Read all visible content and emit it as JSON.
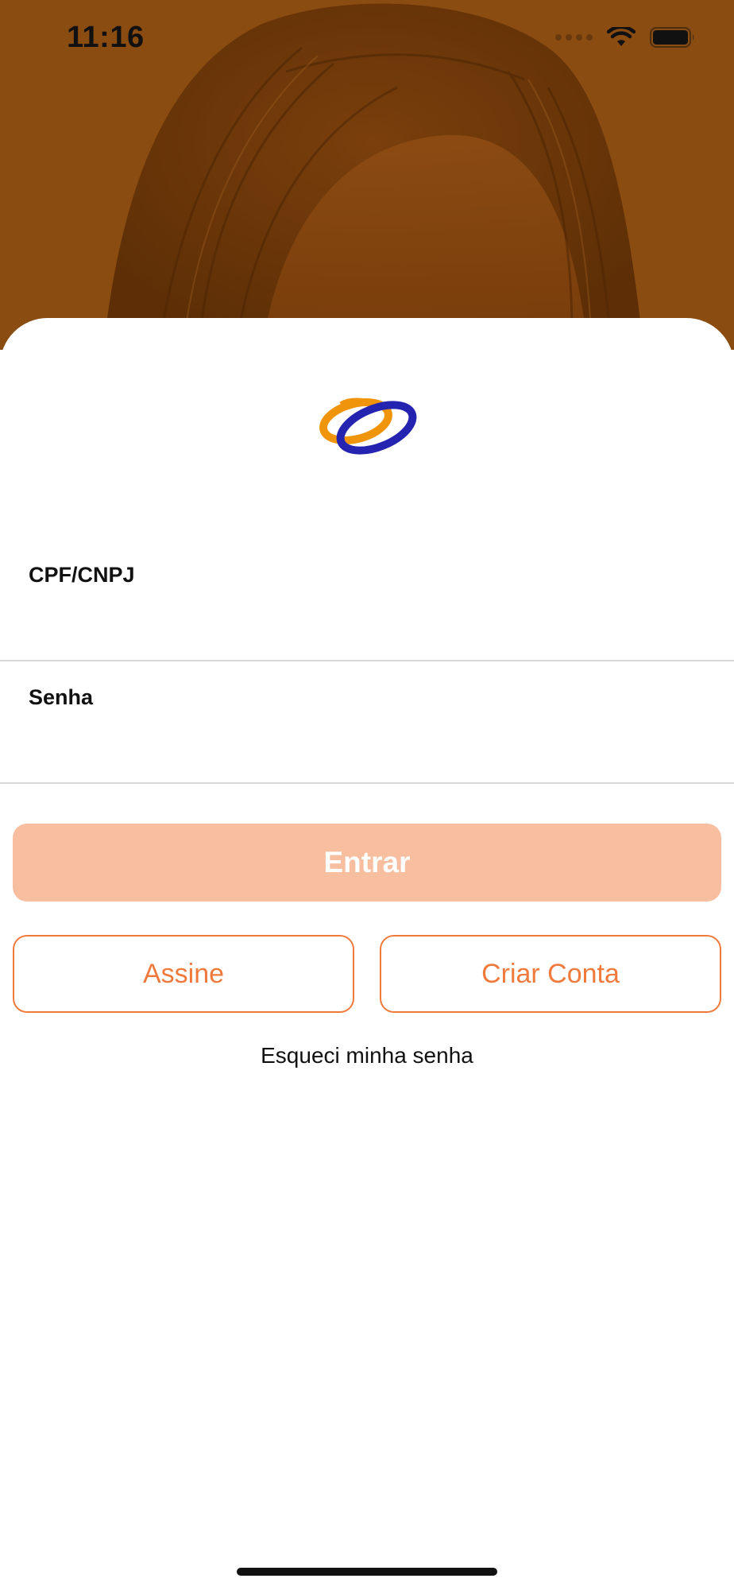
{
  "status_bar": {
    "time": "11:16",
    "icons": [
      "cellular-signal-icon",
      "wifi-icon",
      "battery-icon"
    ]
  },
  "hero": {
    "image": "woman-portrait-photo",
    "tint_color": "#8a4a10"
  },
  "logo": {
    "icon": "rings-logo",
    "colors": {
      "orange": "#f0940c",
      "blue": "#2424b0"
    }
  },
  "form": {
    "cpf_label": "CPF/CNPJ",
    "cpf_value": "",
    "senha_label": "Senha",
    "senha_value": ""
  },
  "buttons": {
    "entrar": "Entrar",
    "assine": "Assine",
    "criar_conta": "Criar Conta"
  },
  "links": {
    "forgot_password": "Esqueci minha senha"
  },
  "colors": {
    "accent": "#f07a3c",
    "primary_disabled": "#f8bea0"
  }
}
